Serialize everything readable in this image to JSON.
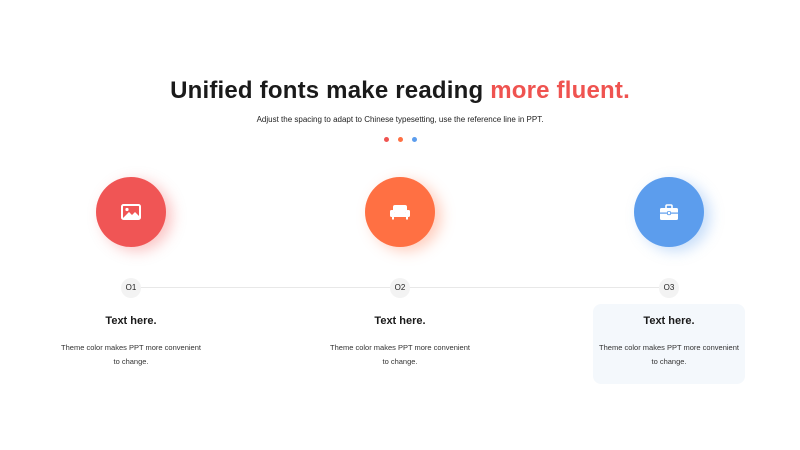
{
  "header": {
    "title_main": "Unified fonts make reading ",
    "title_accent": "more fluent.",
    "subtitle": "Adjust the spacing to adapt to Chinese typesetting, use the reference line in PPT."
  },
  "colors": {
    "accent_red": "#ef5350",
    "accent_orange": "#ff7043",
    "accent_blue": "#5c9ded"
  },
  "steps": [
    {
      "number": "O1",
      "icon": "image-icon",
      "title": "Text here.",
      "text": "Theme color makes PPT more convenient to change."
    },
    {
      "number": "O2",
      "icon": "sofa-icon",
      "title": "Text here.",
      "text": "Theme color makes PPT more convenient to change."
    },
    {
      "number": "O3",
      "icon": "briefcase-icon",
      "title": "Text here.",
      "text": "Theme color makes PPT more convenient to change."
    }
  ]
}
